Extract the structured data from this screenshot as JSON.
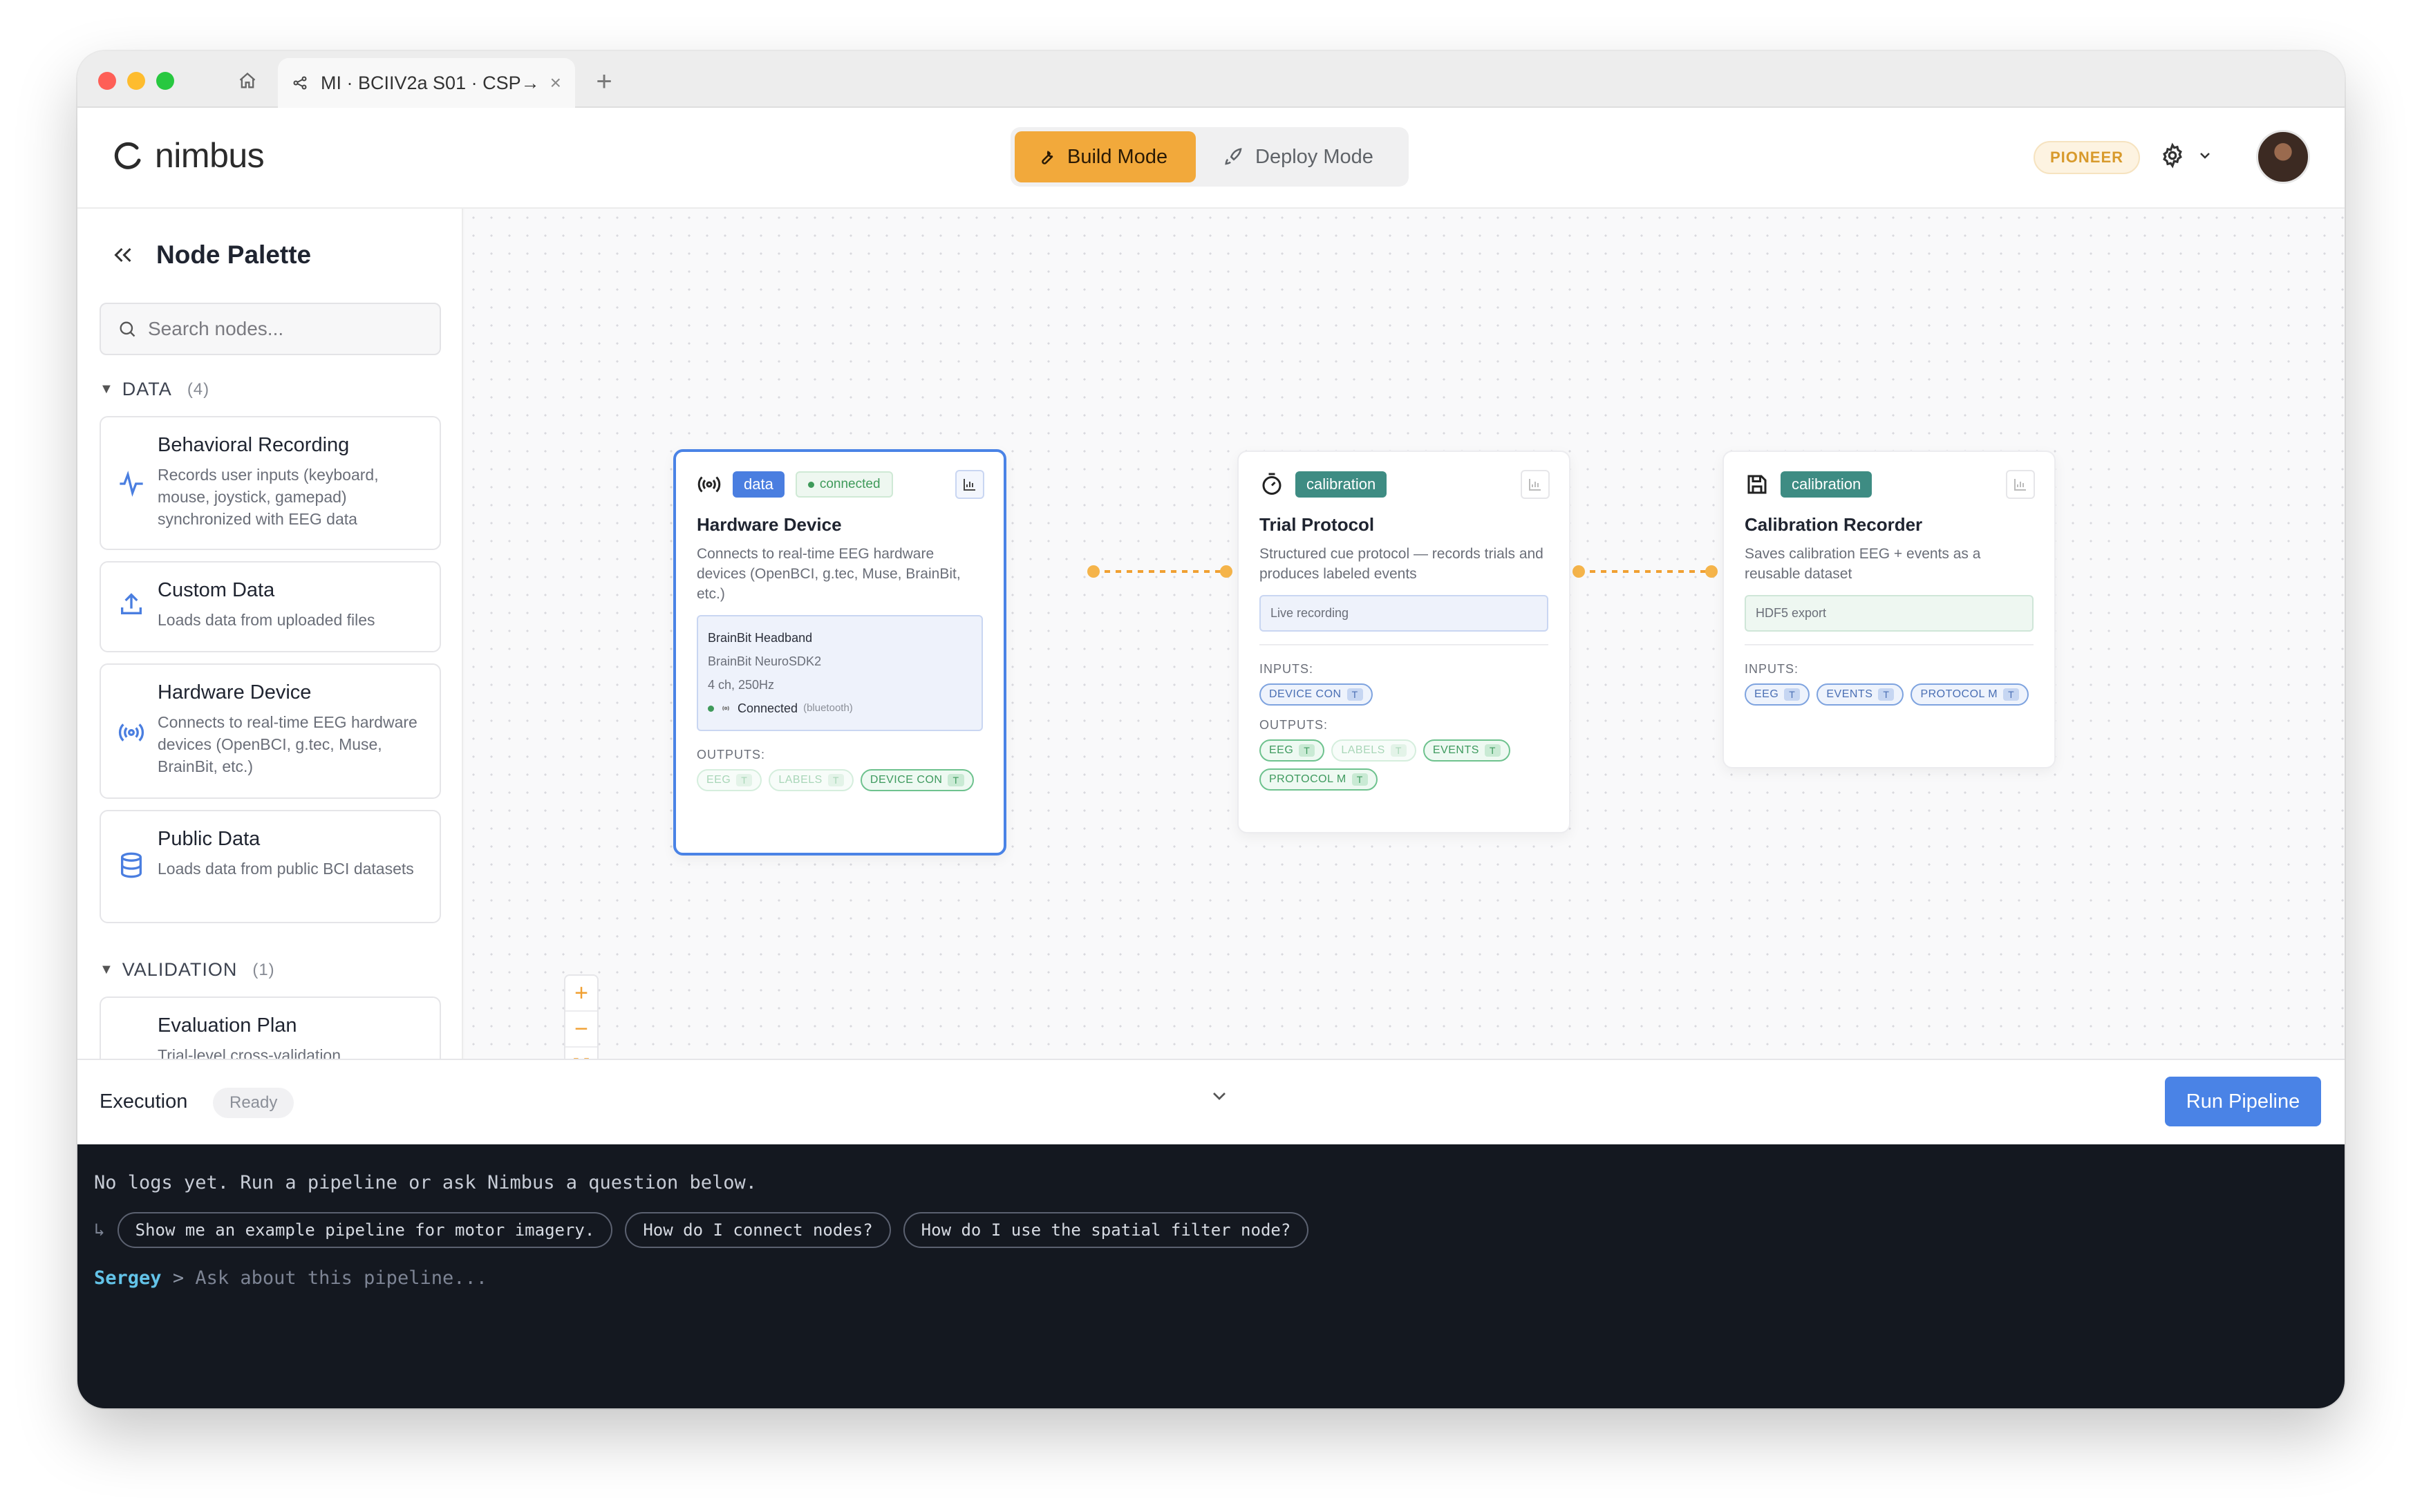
{
  "window": {
    "tab_title": "MI · BCIIV2a S01 · CSP→...",
    "tab_close": "×",
    "new_tab": "+"
  },
  "header": {
    "logo": "nimbus",
    "build_mode": "Build Mode",
    "deploy_mode": "Deploy Mode",
    "plan_badge": "PIONEER"
  },
  "sidebar": {
    "title": "Node Palette",
    "search_placeholder": "Search nodes...",
    "sections": [
      {
        "label": "DATA",
        "count": "(4)",
        "items": [
          {
            "name": "Behavioral Recording",
            "desc": "Records user inputs (keyboard, mouse, joystick, gamepad) synchronized with EEG data"
          },
          {
            "name": "Custom Data",
            "desc": "Loads data from uploaded files"
          },
          {
            "name": "Hardware Device",
            "desc": "Connects to real-time EEG hardware devices (OpenBCI, g.tec, Muse, BrainBit, etc.)"
          },
          {
            "name": "Public Data",
            "desc": "Loads data from public BCI datasets"
          }
        ]
      },
      {
        "label": "VALIDATION",
        "count": "(1)",
        "items": [
          {
            "name": "Evaluation Plan",
            "desc": "Trial-level cross-validation"
          }
        ]
      }
    ]
  },
  "nodes": [
    {
      "tag": "data",
      "status": "connected",
      "title": "Hardware Device",
      "desc": "Connects to real-time EEG hardware devices (OpenBCI, g.tec, Muse, BrainBit, etc.)",
      "device_name": "BrainBit Headband",
      "device_sdk": "BrainBit NeuroSDK2",
      "device_spec": "4 ch, 250Hz",
      "device_status": "Connected",
      "device_transport": "(bluetooth)",
      "outputs_label": "OUTPUTS:",
      "outputs": [
        {
          "label": "EEG",
          "type": "T"
        },
        {
          "label": "LABELS",
          "type": "T"
        },
        {
          "label": "DEVICE CON",
          "type": "T"
        }
      ]
    },
    {
      "tag": "calibration",
      "title": "Trial Protocol",
      "desc": "Structured cue protocol — records trials and produces labeled events",
      "field": "Live recording",
      "inputs_label": "INPUTS:",
      "inputs": [
        {
          "label": "DEVICE CON",
          "type": "T"
        }
      ],
      "outputs_label": "OUTPUTS:",
      "outputs": [
        {
          "label": "EEG",
          "type": "T"
        },
        {
          "label": "LABELS",
          "type": "T"
        },
        {
          "label": "EVENTS",
          "type": "T"
        },
        {
          "label": "PROTOCOL M",
          "type": "T"
        }
      ]
    },
    {
      "tag": "calibration",
      "title": "Calibration Recorder",
      "desc": "Saves calibration EEG + events as a reusable dataset",
      "field": "HDF5 export",
      "inputs_label": "INPUTS:",
      "inputs": [
        {
          "label": "EEG",
          "type": "T"
        },
        {
          "label": "EVENTS",
          "type": "T"
        },
        {
          "label": "PROTOCOL M",
          "type": "T"
        }
      ]
    }
  ],
  "execution": {
    "title": "Execution",
    "status": "Ready",
    "run_button": "Run Pipeline"
  },
  "terminal": {
    "empty_message": "No logs yet. Run a pipeline or ask Nimbus a question below.",
    "suggestion_arrow": "↳",
    "suggestions": [
      "Show me an example pipeline for motor imagery.",
      "How do I connect nodes?",
      "How do I use the spatial filter node?"
    ],
    "user": "Sergey",
    "prompt_symbol": ">",
    "input_placeholder": "Ask about this pipeline..."
  },
  "colors": {
    "accent": "#f2a93b",
    "primary": "#4a83e6",
    "calibration_tag": "#3e8c83",
    "connection": "#f0a032",
    "terminal_bg": "#141820"
  }
}
